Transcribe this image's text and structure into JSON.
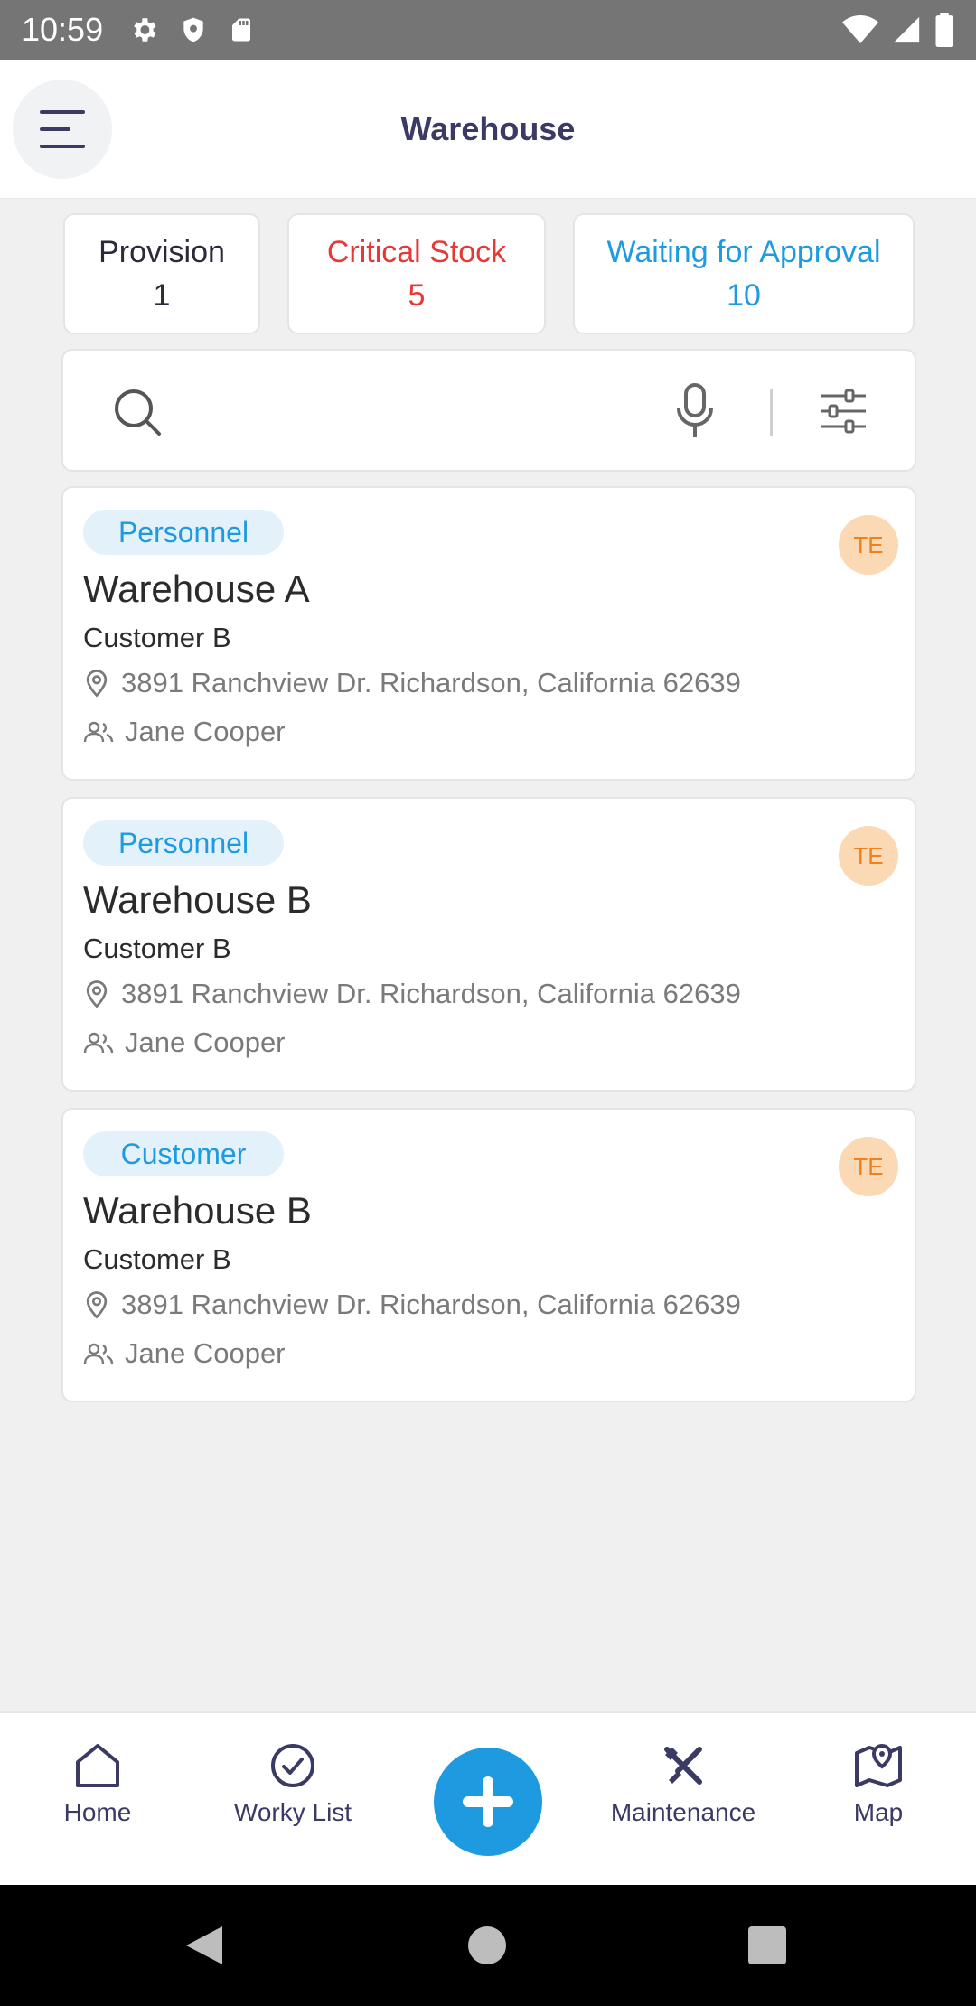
{
  "status_bar": {
    "time": "10:59",
    "icons": [
      "settings-icon",
      "shield-icon",
      "sd-card-icon",
      "wifi-icon",
      "signal-icon",
      "battery-icon"
    ]
  },
  "header": {
    "title": "Warehouse",
    "menu_icon": "hamburger-menu-icon"
  },
  "summary": {
    "provision": {
      "label": "Provision",
      "count": "1"
    },
    "critical": {
      "label": "Critical Stock",
      "count": "5",
      "color": "#e53935"
    },
    "waiting": {
      "label": "Waiting for Approval",
      "count": "10",
      "color": "#1e9be0"
    }
  },
  "search": {
    "placeholder": "",
    "value": ""
  },
  "cards": [
    {
      "tag": "Personnel",
      "avatar": "TE",
      "title": "Warehouse A",
      "customer": "Customer B",
      "address": "3891 Ranchview Dr. Richardson, California 62639",
      "person": "Jane Cooper"
    },
    {
      "tag": "Personnel",
      "avatar": "TE",
      "title": "Warehouse B",
      "customer": "Customer B",
      "address": "3891 Ranchview Dr. Richardson, California 62639",
      "person": "Jane Cooper"
    },
    {
      "tag": "Customer",
      "avatar": "TE",
      "title": "Warehouse B",
      "customer": "Customer B",
      "address": "3891 Ranchview Dr. Richardson, California 62639",
      "person": "Jane Cooper"
    }
  ],
  "bottom_nav": {
    "home": "Home",
    "worky": "Worky List",
    "maintenance": "Maintenance",
    "map": "Map"
  },
  "colors": {
    "accent": "#1e9be0",
    "title": "#3a3a64",
    "avatar_bg": "#fcd9b5",
    "avatar_text": "#f07f1e"
  }
}
